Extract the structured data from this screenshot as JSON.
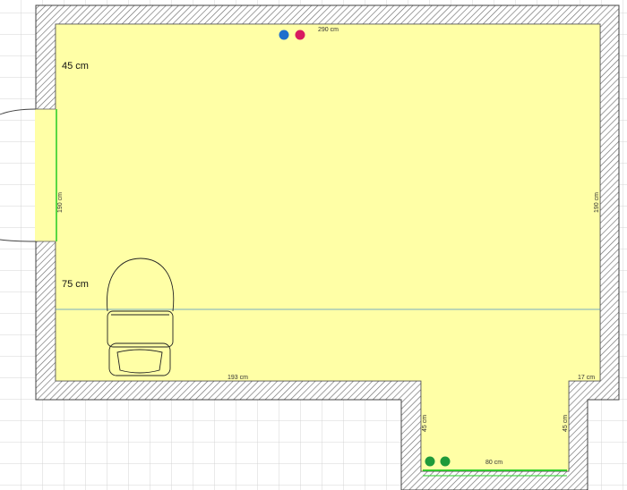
{
  "colors": {
    "floor": "#ffffa6",
    "wall_hatch": "#7a7a7a",
    "grid": "#d4d4d4",
    "opening": "#22cc22",
    "level_line": "#4a90c8",
    "cold_water": "#1e6fcc",
    "hot_water": "#d81b60",
    "drain": "#1f9a3a"
  },
  "labels": {
    "top_wall_width": "290 cm",
    "left_wall_height": "190 cm",
    "right_wall_height": "190 cm",
    "bottom_left_width": "193 cm",
    "bottom_right_width": "17 cm",
    "alcove_left_depth": "45 cm",
    "alcove_right_depth": "45 cm",
    "alcove_width": "80 cm",
    "upper_height_mark": "45 cm",
    "lower_height_mark": "75 cm"
  },
  "fixtures": {
    "toilet": "toilet-icon",
    "door": "door-swing-icon",
    "water_inlets": [
      "cold-water-inlet",
      "hot-water-inlet"
    ],
    "drains": [
      "drain-1",
      "drain-2"
    ]
  }
}
